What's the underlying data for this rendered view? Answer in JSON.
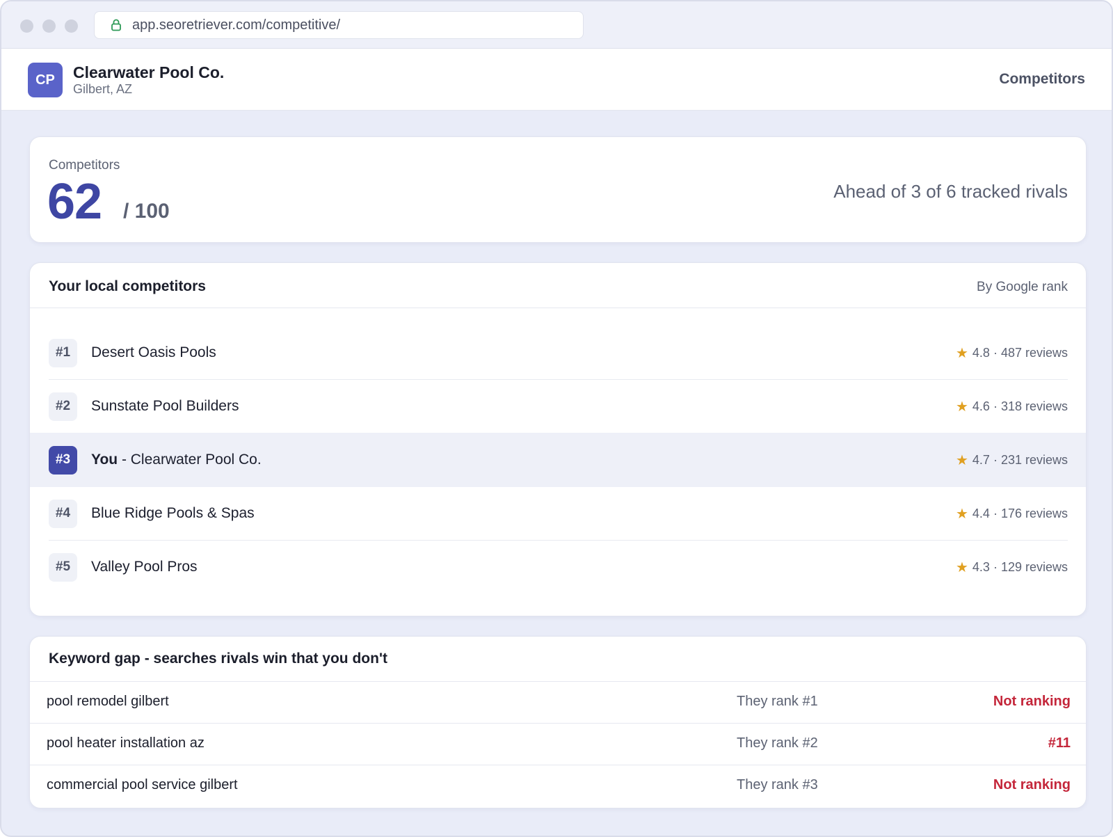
{
  "browser": {
    "url": "app.seoretriever.com/competitive/"
  },
  "header": {
    "logo_initials": "CP",
    "business_name": "Clearwater Pool Co.",
    "location": "Gilbert, AZ",
    "nav_label": "Competitors"
  },
  "score": {
    "label": "Competitors",
    "value": "62",
    "max": "/ 100",
    "summary": "Ahead of 3 of 6 tracked rivals"
  },
  "competitors": {
    "title": "Your local competitors",
    "sort_label": "By Google rank",
    "rows": [
      {
        "rank": "#1",
        "you_label": "",
        "name": "Desert Oasis Pools",
        "star": "★",
        "rating": "4.8 · 487 reviews"
      },
      {
        "rank": "#2",
        "you_label": "",
        "name": "Sunstate Pool Builders",
        "star": "★",
        "rating": "4.6 · 318 reviews"
      },
      {
        "rank": "#3",
        "you_label": "You",
        "name": " - Clearwater Pool Co.",
        "star": "★",
        "rating": "4.7 · 231 reviews"
      },
      {
        "rank": "#4",
        "you_label": "",
        "name": "Blue Ridge Pools & Spas",
        "star": "★",
        "rating": "4.4 · 176 reviews"
      },
      {
        "rank": "#5",
        "you_label": "",
        "name": "Valley Pool Pros",
        "star": "★",
        "rating": "4.3 · 129 reviews"
      }
    ]
  },
  "keyword_gap": {
    "title": "Keyword gap - searches rivals win that you don't",
    "rows": [
      {
        "keyword": "pool remodel gilbert",
        "their_rank": "They rank #1",
        "your_rank": "Not ranking"
      },
      {
        "keyword": "pool heater installation az",
        "their_rank": "They rank #2",
        "your_rank": "#11"
      },
      {
        "keyword": "commercial pool service gilbert",
        "their_rank": "They rank #3",
        "your_rank": "Not ranking"
      }
    ]
  },
  "colors": {
    "accent": "#424aa8",
    "star": "#e0a021",
    "negative": "#c4263a",
    "background": "#e9ecf8"
  }
}
